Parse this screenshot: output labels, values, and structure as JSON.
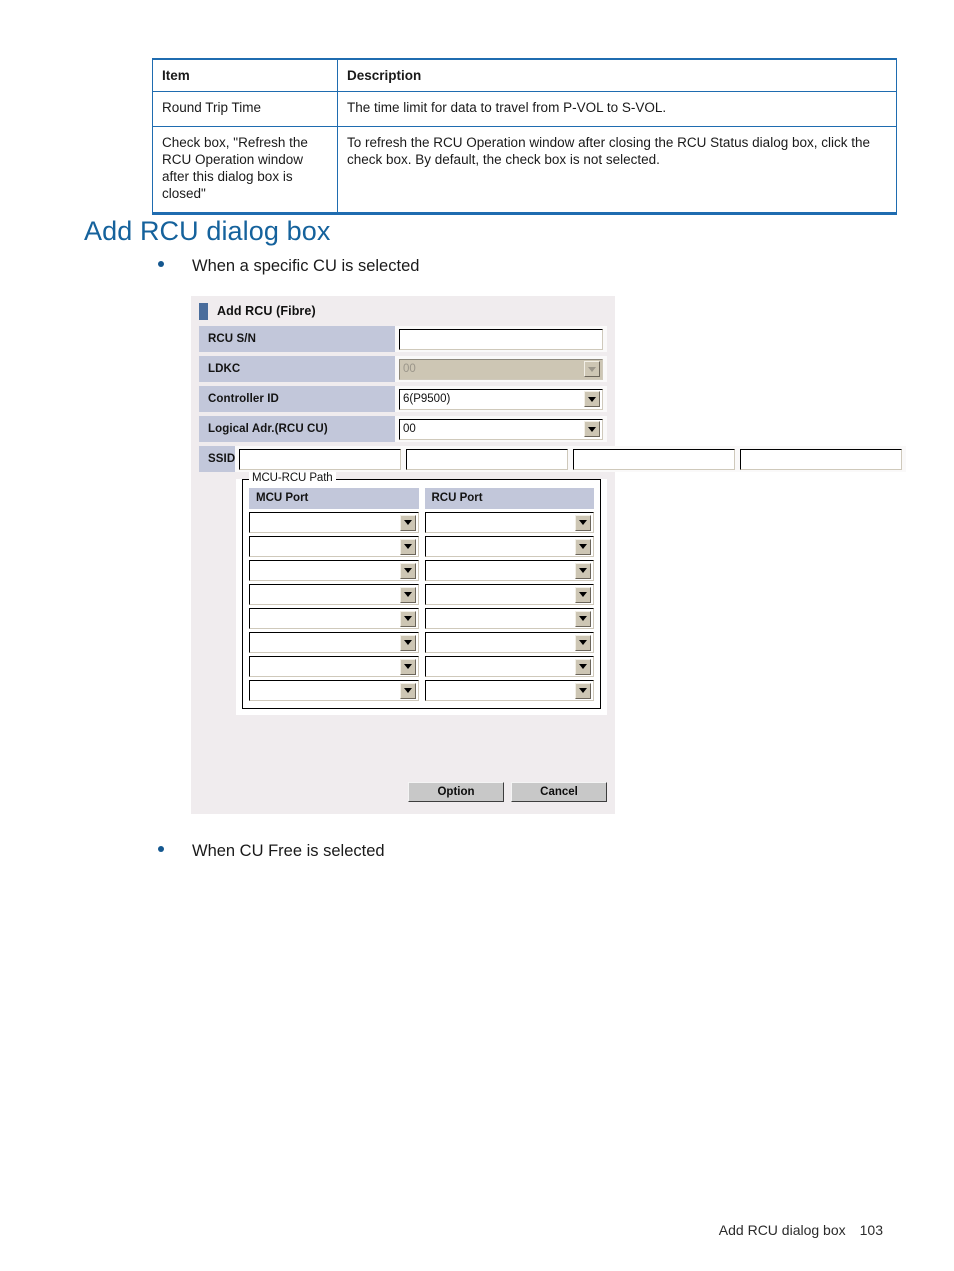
{
  "reference_table": {
    "headers": [
      "Item",
      "Description"
    ],
    "rows": [
      {
        "item": "Round Trip Time",
        "description": "The time limit for data to travel from P-VOL to S-VOL."
      },
      {
        "item": "Check box, \"Refresh the RCU Operation window after this dialog box is closed\"",
        "description": "To refresh the RCU Operation window after closing the RCU Status dialog box, click the check box. By default, the check box is not selected."
      }
    ]
  },
  "section": {
    "title": "Add RCU dialog box"
  },
  "bullets": [
    {
      "text": "When a specific CU is selected"
    },
    {
      "text": "When CU Free is selected"
    }
  ],
  "dialog": {
    "title": "Add RCU (Fibre)",
    "fields": {
      "rcu_sn": {
        "label": "RCU S/N",
        "value": "",
        "type": "text"
      },
      "ldkc": {
        "label": "LDKC",
        "value": "00",
        "type": "combo",
        "disabled": true
      },
      "controller_id": {
        "label": "Controller ID",
        "value": "6(P9500)",
        "type": "combo",
        "disabled": false
      },
      "logical_adr": {
        "label": "Logical Adr.(RCU CU)",
        "value": "00",
        "type": "combo",
        "disabled": false
      },
      "ssid": {
        "label": "SSID",
        "values": [
          "",
          "",
          "",
          ""
        ]
      }
    },
    "path_group": {
      "legend": "MCU-RCU Path",
      "columns": [
        "MCU Port",
        "RCU Port"
      ],
      "rows": [
        {
          "mcu_port": "",
          "rcu_port": ""
        },
        {
          "mcu_port": "",
          "rcu_port": ""
        },
        {
          "mcu_port": "",
          "rcu_port": ""
        },
        {
          "mcu_port": "",
          "rcu_port": ""
        },
        {
          "mcu_port": "",
          "rcu_port": ""
        },
        {
          "mcu_port": "",
          "rcu_port": ""
        },
        {
          "mcu_port": "",
          "rcu_port": ""
        },
        {
          "mcu_port": "",
          "rcu_port": ""
        }
      ]
    },
    "buttons": {
      "option": "Option",
      "cancel": "Cancel"
    }
  },
  "footer": {
    "label": "Add RCU dialog box",
    "page": "103"
  },
  "colors": {
    "heading": "#15629c",
    "table_border": "#1f6cb0",
    "label_bg": "#c2c7da",
    "dialog_bg": "#f0ecee",
    "bullet": "#14578f",
    "title_marker": "#4a6d9c"
  }
}
